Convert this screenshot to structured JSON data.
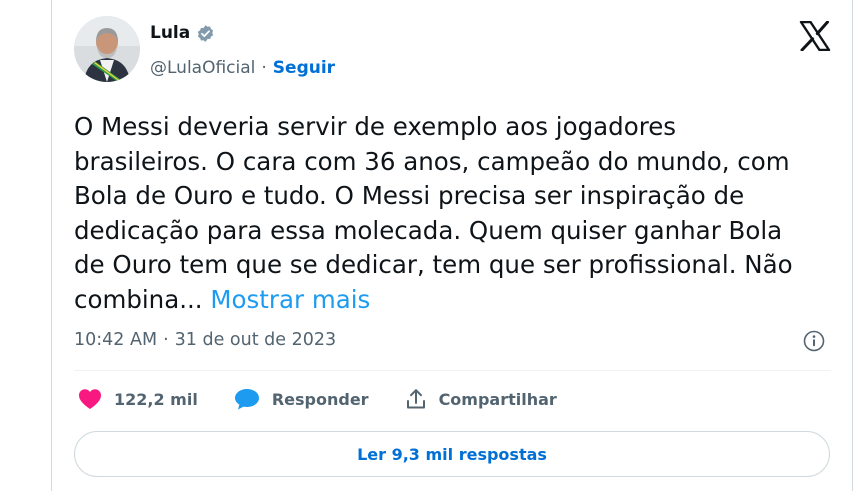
{
  "author": {
    "name": "Lula",
    "handle": "@LulaOficial",
    "separator": "·",
    "follow_label": "Seguir"
  },
  "tweet": {
    "text": "O Messi deveria servir de exemplo aos jogadores\nbrasileiros. O cara com 36 anos, campeão do mundo, com\nBola de Ouro e tudo. O Messi precisa ser inspiração de\ndedicação para essa molecada. Quem quiser ganhar Bola\nde Ouro tem que se dedicar, tem que ser profissional. Não\ncombina...",
    "show_more_label": "Mostrar mais",
    "time": "10:42 AM",
    "date_separator": "·",
    "date": "31 de out de 2023"
  },
  "actions": {
    "likes": "122,2 mil",
    "reply_label": "Responder",
    "share_label": "Compartilhar"
  },
  "replies_button": {
    "label": "Ler 9,3 mil respostas"
  },
  "colors": {
    "link": "#1d9bf0",
    "follow": "#006fd6",
    "heart": "#f91880",
    "secondary_text": "#536471",
    "border": "#cfd9de"
  },
  "icons": {
    "brand": "x-logo-icon",
    "verified": "verified-badge-icon",
    "like": "heart-icon",
    "reply": "speech-bubble-icon",
    "share": "share-upload-icon",
    "info": "info-icon"
  }
}
